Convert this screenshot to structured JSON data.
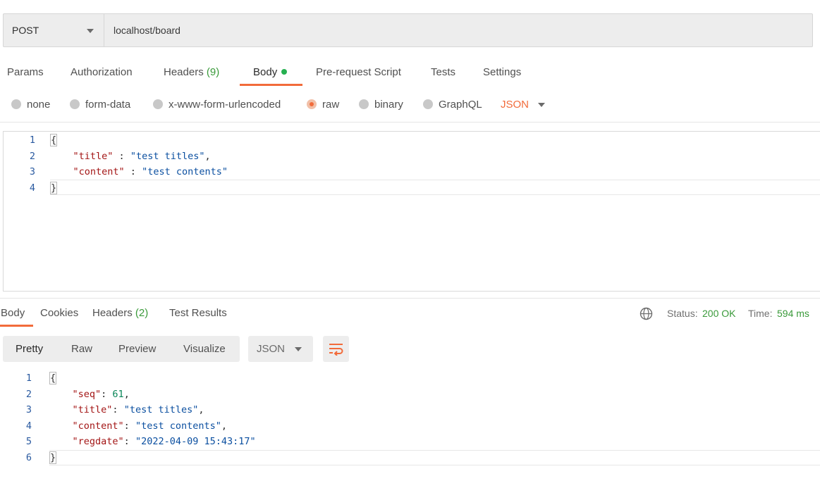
{
  "request": {
    "method": "POST",
    "url": "localhost/board"
  },
  "request_tabs": {
    "params": "Params",
    "authorization": "Authorization",
    "headers": "Headers",
    "headers_count": "(9)",
    "body": "Body",
    "prerequest": "Pre-request Script",
    "tests": "Tests",
    "settings": "Settings"
  },
  "body_types": {
    "none": "none",
    "form_data": "form-data",
    "urlencoded": "x-www-form-urlencoded",
    "raw": "raw",
    "binary": "binary",
    "graphql": "GraphQL",
    "selected_format": "JSON"
  },
  "request_body": {
    "line_numbers": [
      "1",
      "2",
      "3",
      "4"
    ],
    "open_brace": "{",
    "close_brace": "}",
    "title_key": "\"title\"",
    "title_value": "\"test titles\"",
    "content_key": "\"content\"",
    "content_value": "\"test contents\""
  },
  "response_tabs": {
    "body": "Body",
    "cookies": "Cookies",
    "headers": "Headers",
    "headers_count": "(2)",
    "test_results": "Test Results"
  },
  "status": {
    "status_label": "Status:",
    "status_value": "200 OK",
    "time_label": "Time:",
    "time_value": "594 ms"
  },
  "view_modes": {
    "pretty": "Pretty",
    "raw": "Raw",
    "preview": "Preview",
    "visualize": "Visualize",
    "format": "JSON"
  },
  "response_body": {
    "line_numbers": [
      "1",
      "2",
      "3",
      "4",
      "5",
      "6"
    ],
    "open_brace": "{",
    "close_brace": "}",
    "seq_key": "\"seq\"",
    "seq_value": "61",
    "title_key": "\"title\"",
    "title_value": "\"test titles\"",
    "content_key": "\"content\"",
    "content_value": "\"test contents\"",
    "regdate_key": "\"regdate\"",
    "regdate_value": "\"2022-04-09 15:43:17\""
  },
  "colors": {
    "accent": "#f26b3a",
    "success": "#3a9a3a",
    "json_key": "#a31515",
    "json_string": "#0b4fa0",
    "json_number": "#098658"
  },
  "icons": {
    "method_caret": "chevron-down-icon",
    "format_caret": "chevron-down-icon",
    "globe": "globe-icon",
    "wrap": "word-wrap-icon"
  }
}
